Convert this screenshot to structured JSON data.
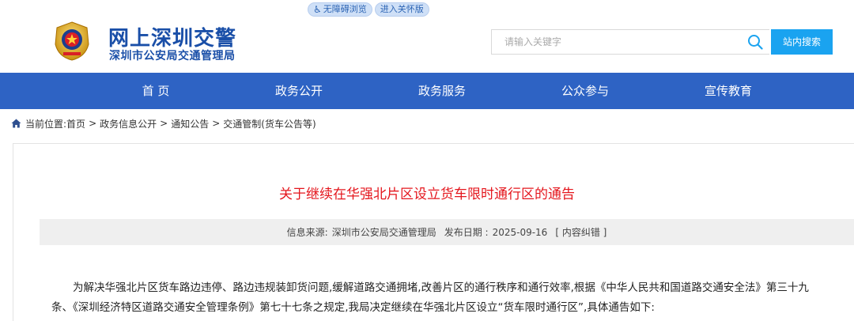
{
  "top_bar": {
    "accessibility_label": "无障碍浏览",
    "elderly_label": "进入关怀版"
  },
  "header": {
    "site_title": "网上深圳交警",
    "site_subtitle": "深圳市公安局交通管理局",
    "search_placeholder": "请输入关键字",
    "search_button": "站内搜索"
  },
  "nav": {
    "items": [
      "首 页",
      "政务公开",
      "政务服务",
      "公众参与",
      "宣传教育"
    ]
  },
  "breadcrumb": {
    "prefix": "当前位置:",
    "items": [
      "首页",
      "政务信息公开",
      "通知公告",
      "交通管制(货车公告等)"
    ],
    "separator": ">"
  },
  "article": {
    "title": "关于继续在华强北片区设立货车限时通行区的通告",
    "source_label": "信息来源:",
    "source": "深圳市公安局交通管理局",
    "date_label": "发布日期 :",
    "date": "2025-09-16",
    "error_link": "[ 内容纠错 ]",
    "body": "为解决华强北片区货车路边违停、路边违规装卸货问题,缓解道路交通拥堵,改善片区的通行秩序和通行效率,根据《中华人民共和国道路交通安全法》第三十九条、《深圳经济特区道路交通安全管理条例》第七十七条之规定,我局决定继续在华强北片区设立“货车限时通行区”,具体通告如下:"
  },
  "colors": {
    "brand_blue": "#1a4fa8",
    "nav_blue": "#2e63c4",
    "search_button": "#1aa3f0",
    "title_red": "#e4161d"
  },
  "icons": {
    "emblem": "police-emblem-icon",
    "search": "search-icon",
    "home": "home-icon",
    "accessibility": "wheelchair-icon"
  }
}
